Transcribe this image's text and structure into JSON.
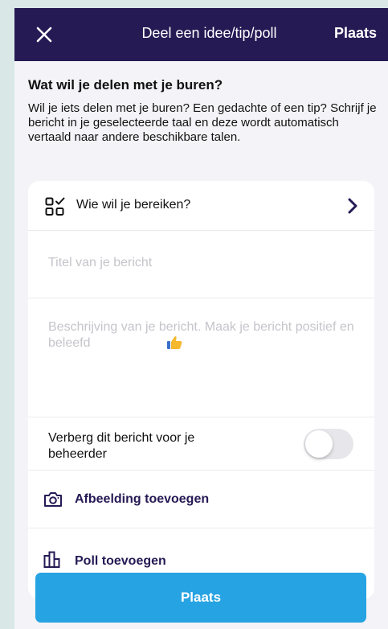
{
  "header": {
    "title": "Deel een idee/tip/poll",
    "action_label": "Plaats"
  },
  "intro": {
    "heading": "Wat wil je delen met je buren?",
    "body": "Wil je iets delen met je buren? Een gedachte of een tip? Schrijf je bericht in je geselecteerde taal en deze wordt automatisch vertaald naar andere beschikbare talen."
  },
  "form": {
    "audience_label": "Wie wil je bereiken?",
    "title_placeholder": "Titel van je bericht",
    "description_placeholder": "Beschrijving van je bericht. Maak je bericht positief en beleefd",
    "hide_label": "Verberg dit bericht voor je beheerder",
    "hide_toggle_on": false,
    "add_photo_label": "Afbeelding toevoegen",
    "add_poll_label": "Poll toevoegen"
  },
  "submit_label": "Plaats",
  "colors": {
    "header_bg": "#261a55",
    "primary_button": "#26a3e3",
    "link_text": "#261a55",
    "thumb_emoji": "#f5b82e"
  },
  "icons": {
    "close": "close-icon",
    "audience": "audience-grid-icon",
    "chevron": "chevron-right-icon",
    "thumb": "thumbs-up-icon",
    "camera": "camera-icon",
    "poll": "poll-icon"
  }
}
